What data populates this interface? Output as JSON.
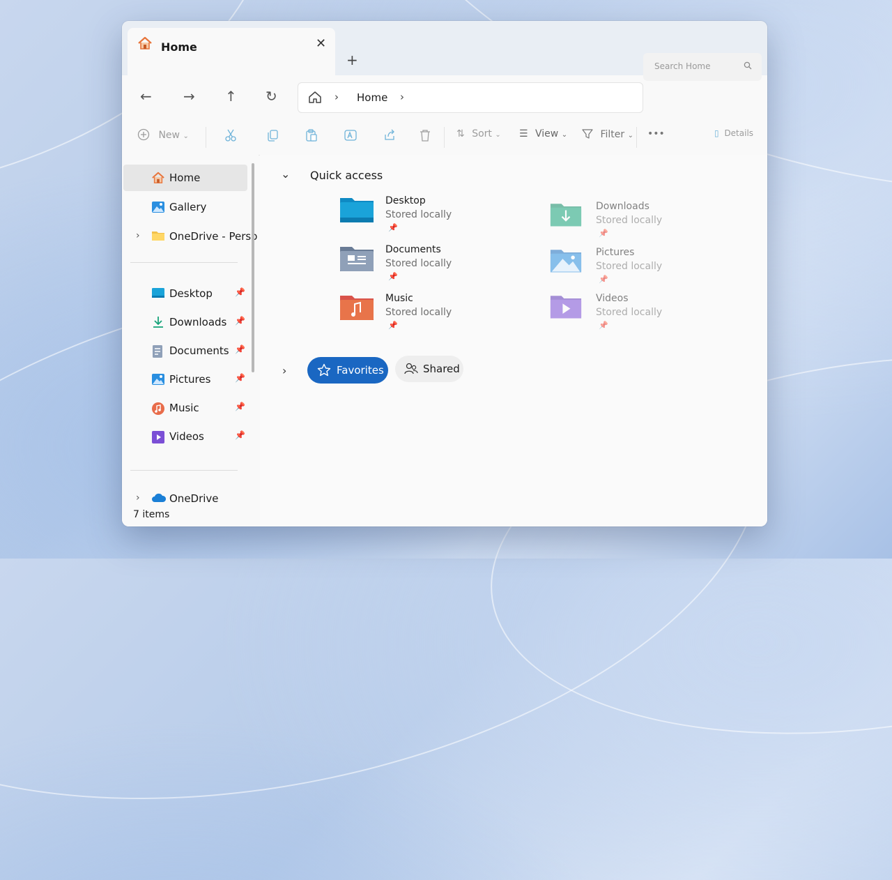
{
  "tab": {
    "title": "Home",
    "close": "✕",
    "new_tab": "+"
  },
  "window_controls": {
    "minimize": "—",
    "maximize": "▢",
    "close": "✕"
  },
  "nav": {
    "back": "←",
    "forward": "→",
    "up": "↑",
    "refresh": "↻"
  },
  "address": {
    "separator": "›",
    "current": "Home"
  },
  "search": {
    "placeholder": "Search Home"
  },
  "toolbar": {
    "new_label": "New",
    "sort_label": "Sort",
    "view_label": "View",
    "filter_label": "Filter",
    "more": "•••",
    "details_label": "Details"
  },
  "sidebar": {
    "items": [
      {
        "label": "Home",
        "icon": "home-icon",
        "active": true
      },
      {
        "label": "Gallery",
        "icon": "gallery-icon"
      },
      {
        "label": "OneDrive - Perso",
        "icon": "folder-icon"
      },
      {
        "label": "Desktop",
        "icon": "desktop-icon",
        "pinned": true
      },
      {
        "label": "Downloads",
        "icon": "downloads-icon",
        "pinned": true
      },
      {
        "label": "Documents",
        "icon": "documents-icon",
        "pinned": true
      },
      {
        "label": "Pictures",
        "icon": "pictures-icon",
        "pinned": true
      },
      {
        "label": "Music",
        "icon": "music-icon",
        "pinned": true
      },
      {
        "label": "Videos",
        "icon": "videos-icon",
        "pinned": true
      },
      {
        "label": "OneDrive",
        "icon": "cloud-icon"
      }
    ],
    "pin": "📌",
    "chevron": "›"
  },
  "status": {
    "items": "7 items"
  },
  "quick_access": {
    "title": "Quick access",
    "chevron": "⌄",
    "folders": [
      {
        "name": "Desktop",
        "sub": "Stored locally",
        "icon": "desktop-folder-icon",
        "color": "#1aa3d9"
      },
      {
        "name": "Downloads",
        "sub": "Stored locally",
        "icon": "downloads-folder-icon",
        "color": "#17a37a"
      },
      {
        "name": "Documents",
        "sub": "Stored locally",
        "icon": "documents-folder-icon",
        "color": "#7d8fa8"
      },
      {
        "name": "Pictures",
        "sub": "Stored locally",
        "icon": "pictures-folder-icon",
        "color": "#2a8fe0"
      },
      {
        "name": "Music",
        "sub": "Stored locally",
        "icon": "music-folder-icon",
        "color": "#e86c4a"
      },
      {
        "name": "Videos",
        "sub": "Stored locally",
        "icon": "videos-folder-icon",
        "color": "#7b4fd6"
      }
    ]
  },
  "pills": {
    "favorites": "Favorites",
    "shared": "Shared",
    "chevron": "›"
  },
  "colors": {
    "accent": "#1a67c2",
    "window_bg": "#f9f9f9",
    "home_orange": "#e8743a"
  }
}
